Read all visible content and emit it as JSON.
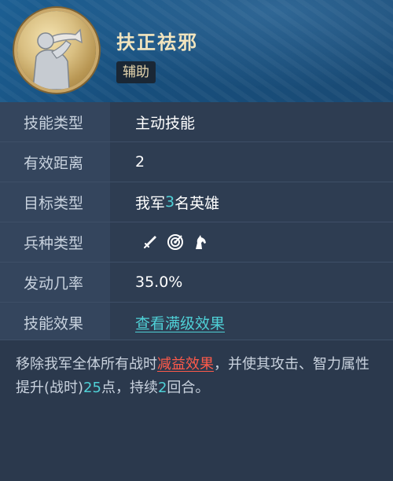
{
  "skill": {
    "title": "扶正祛邪",
    "type_badge": "辅助"
  },
  "rows": [
    {
      "label": "技能类型",
      "value": "主动技能"
    },
    {
      "label": "有效距离",
      "value": "2"
    },
    {
      "label": "目标类型",
      "value_prefix": "我军",
      "value_num": "3",
      "value_suffix": "名英雄"
    },
    {
      "label": "兵种类型",
      "icons": [
        "sword-icon",
        "target-icon",
        "horse-icon"
      ]
    },
    {
      "label": "发动几率",
      "value": "35.0%"
    },
    {
      "label": "技能效果",
      "value": "查看满级效果"
    }
  ],
  "description": {
    "part1": "移除我军全体所有战时",
    "highlight": "减益效果",
    "part2": "，并使其攻击、智力属性提升(战时)",
    "num1": "25",
    "part3": "点，持续",
    "num2": "2",
    "part4": "回合。"
  },
  "colors": {
    "header": "#1c5f93",
    "cyan": "#4fd0d6",
    "red": "#ff5a4a",
    "title": "#f1e4be"
  }
}
